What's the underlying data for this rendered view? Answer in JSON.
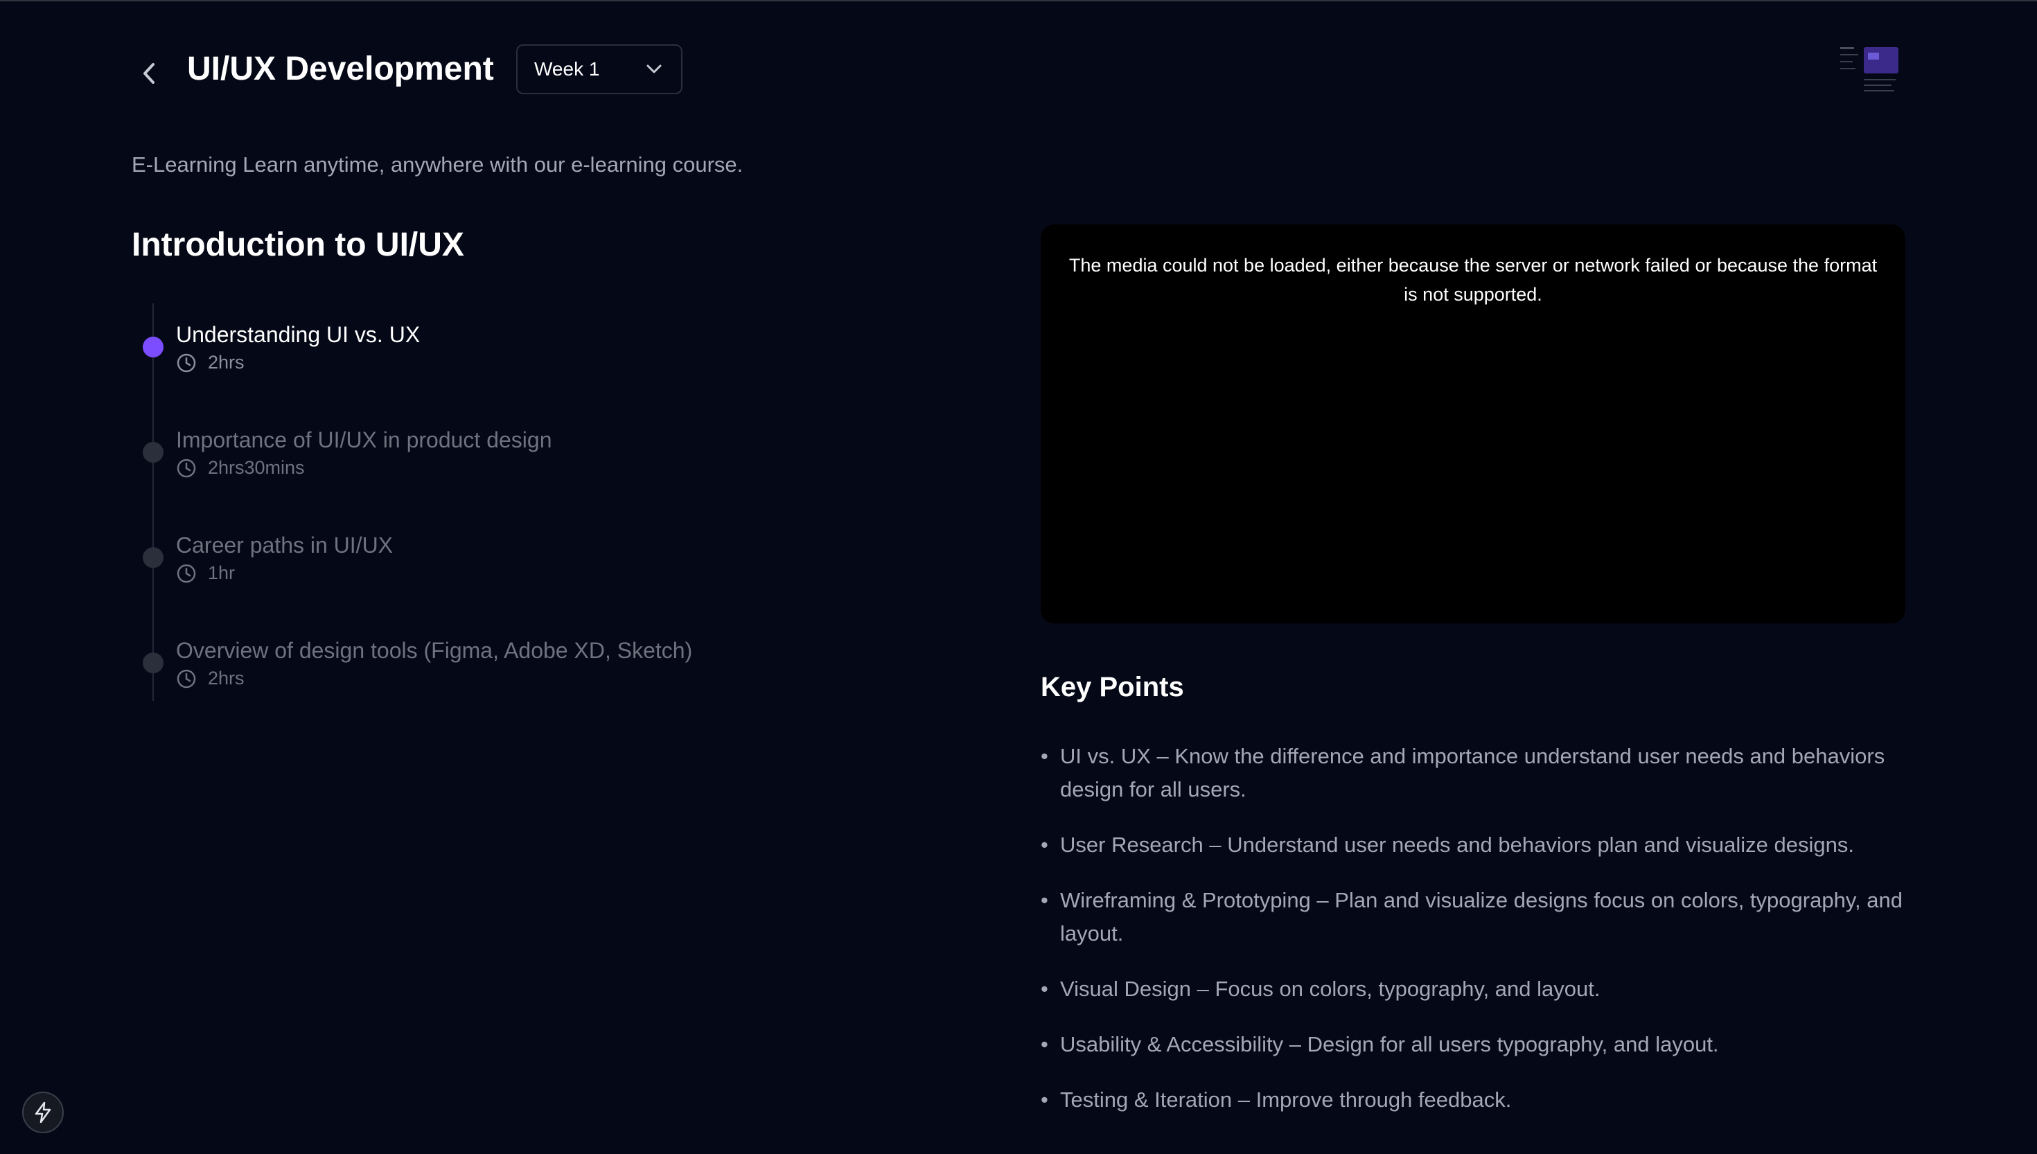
{
  "header": {
    "back_label": "Back",
    "title": "UI/UX Development",
    "week_select": {
      "value": "Week 1"
    }
  },
  "subtitle": "E-Learning Learn anytime, anywhere with our e-learning course.",
  "section": {
    "title": "Introduction to UI/UX",
    "lessons": [
      {
        "title": "Understanding UI vs. UX",
        "duration": "2hrs",
        "active": true
      },
      {
        "title": "Importance of UI/UX in product design",
        "duration": "2hrs30mins",
        "active": false
      },
      {
        "title": "Career paths in UI/UX",
        "duration": "1hr",
        "active": false
      },
      {
        "title": "Overview of design tools (Figma, Adobe XD, Sketch)",
        "duration": "2hrs",
        "active": false
      }
    ]
  },
  "video": {
    "error_message": "The media could not be loaded, either because the server or network failed or because the format is not supported."
  },
  "key_points": {
    "title": "Key Points",
    "items": [
      "UI vs. UX – Know the difference and importance understand user needs and behaviors design for all users.",
      "User Research – Understand user needs and behaviors plan and visualize designs.",
      "Wireframing & Prototyping – Plan and visualize designs focus on colors, typography, and layout.",
      "Visual Design – Focus on colors, typography, and layout.",
      "Usability & Accessibility – Design for all users typography, and layout.",
      "Testing & Iteration – Improve through feedback."
    ]
  },
  "colors": {
    "background": "#050816",
    "accent": "#7c4dff",
    "muted_text": "#a3a8b6",
    "inactive_text": "#6e7380"
  },
  "icons": {
    "back": "chevron-left-icon",
    "dropdown": "chevron-down-icon",
    "duration": "clock-icon",
    "dev_tools": "lightning-bolt-icon"
  }
}
